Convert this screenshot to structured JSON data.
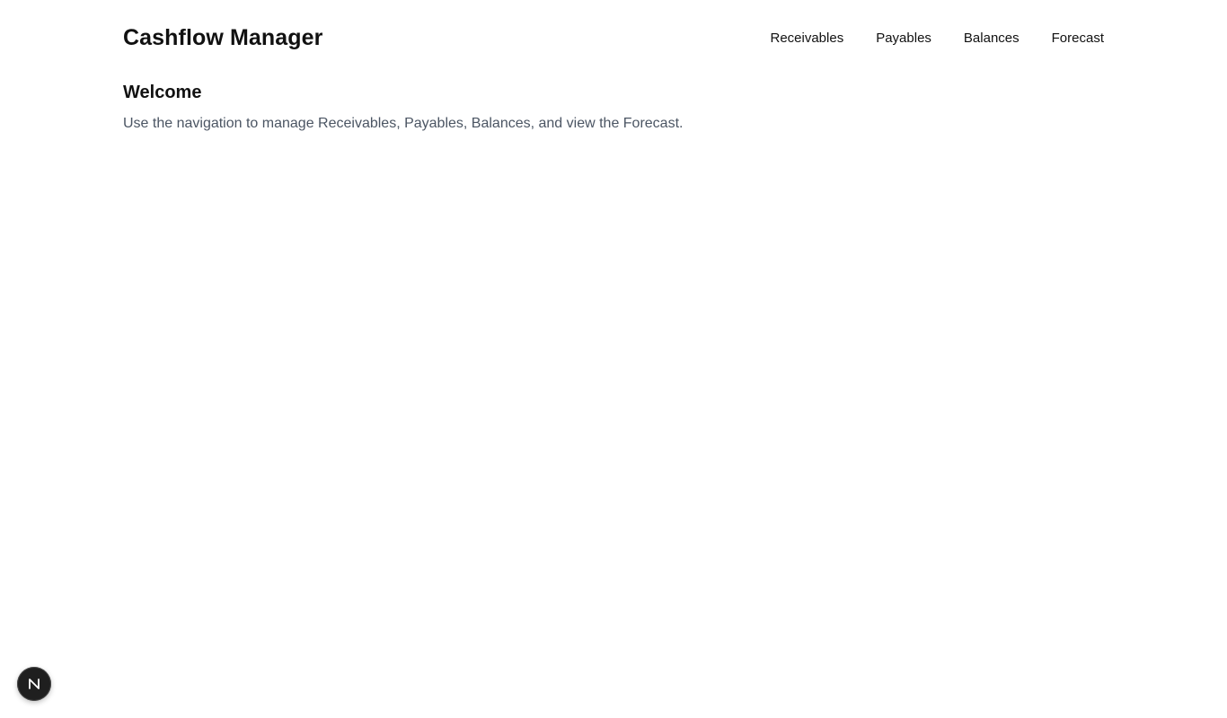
{
  "header": {
    "brand": "Cashflow Manager",
    "nav": [
      {
        "label": "Receivables"
      },
      {
        "label": "Payables"
      },
      {
        "label": "Balances"
      },
      {
        "label": "Forecast"
      }
    ]
  },
  "main": {
    "title": "Welcome",
    "description": "Use the navigation to manage Receivables, Payables, Balances, and view the Forecast."
  },
  "dev_badge": {
    "icon": "nextjs-n-icon",
    "letter": "N"
  },
  "colors": {
    "text_primary": "#111111",
    "text_secondary": "#4b5563",
    "badge_bg": "#1f1f1f"
  }
}
